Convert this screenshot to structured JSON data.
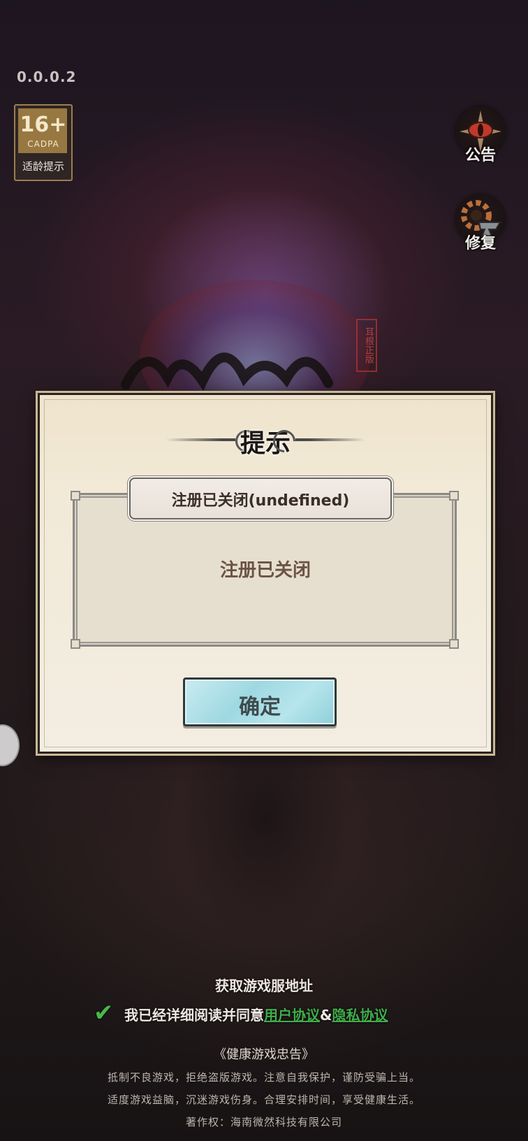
{
  "app": {
    "version": "0.0.0.2"
  },
  "age_rating": {
    "age": "16+",
    "org": "CADPA",
    "tip": "适龄提示"
  },
  "side_buttons": {
    "notice": "公告",
    "repair": "修复"
  },
  "title_stamp": "耳根正版",
  "dialog": {
    "title": "提示",
    "subtitle": "注册已关闭(undefined)",
    "message": "注册已关闭",
    "confirm_label": "确定"
  },
  "footer": {
    "server_link": "获取游戏服地址",
    "agree_prefix": "我已经详细阅读并同意",
    "user_agreement": "用户协议",
    "ampersand": "&",
    "privacy_policy": "隐私协议",
    "health_title": "《健康游戏忠告》",
    "health_line_1": "抵制不良游戏，拒绝盗版游戏。注意自我保护，谨防受骗上当。",
    "health_line_2": "适度游戏益脑，沉迷游戏伤身。合理安排时间，享受健康生活。",
    "copyright": "著作权：海南微然科技有限公司"
  },
  "colors": {
    "dialog_bg": "#f2ead8",
    "confirm_button": "#9fd8e2",
    "link_green": "#3fae4a",
    "check_green": "#46b94a"
  },
  "icons": {
    "notice": "eye-compass-icon",
    "repair": "gear-anvil-icon",
    "agree": "checkmark-icon",
    "float": "cloud-icon"
  }
}
